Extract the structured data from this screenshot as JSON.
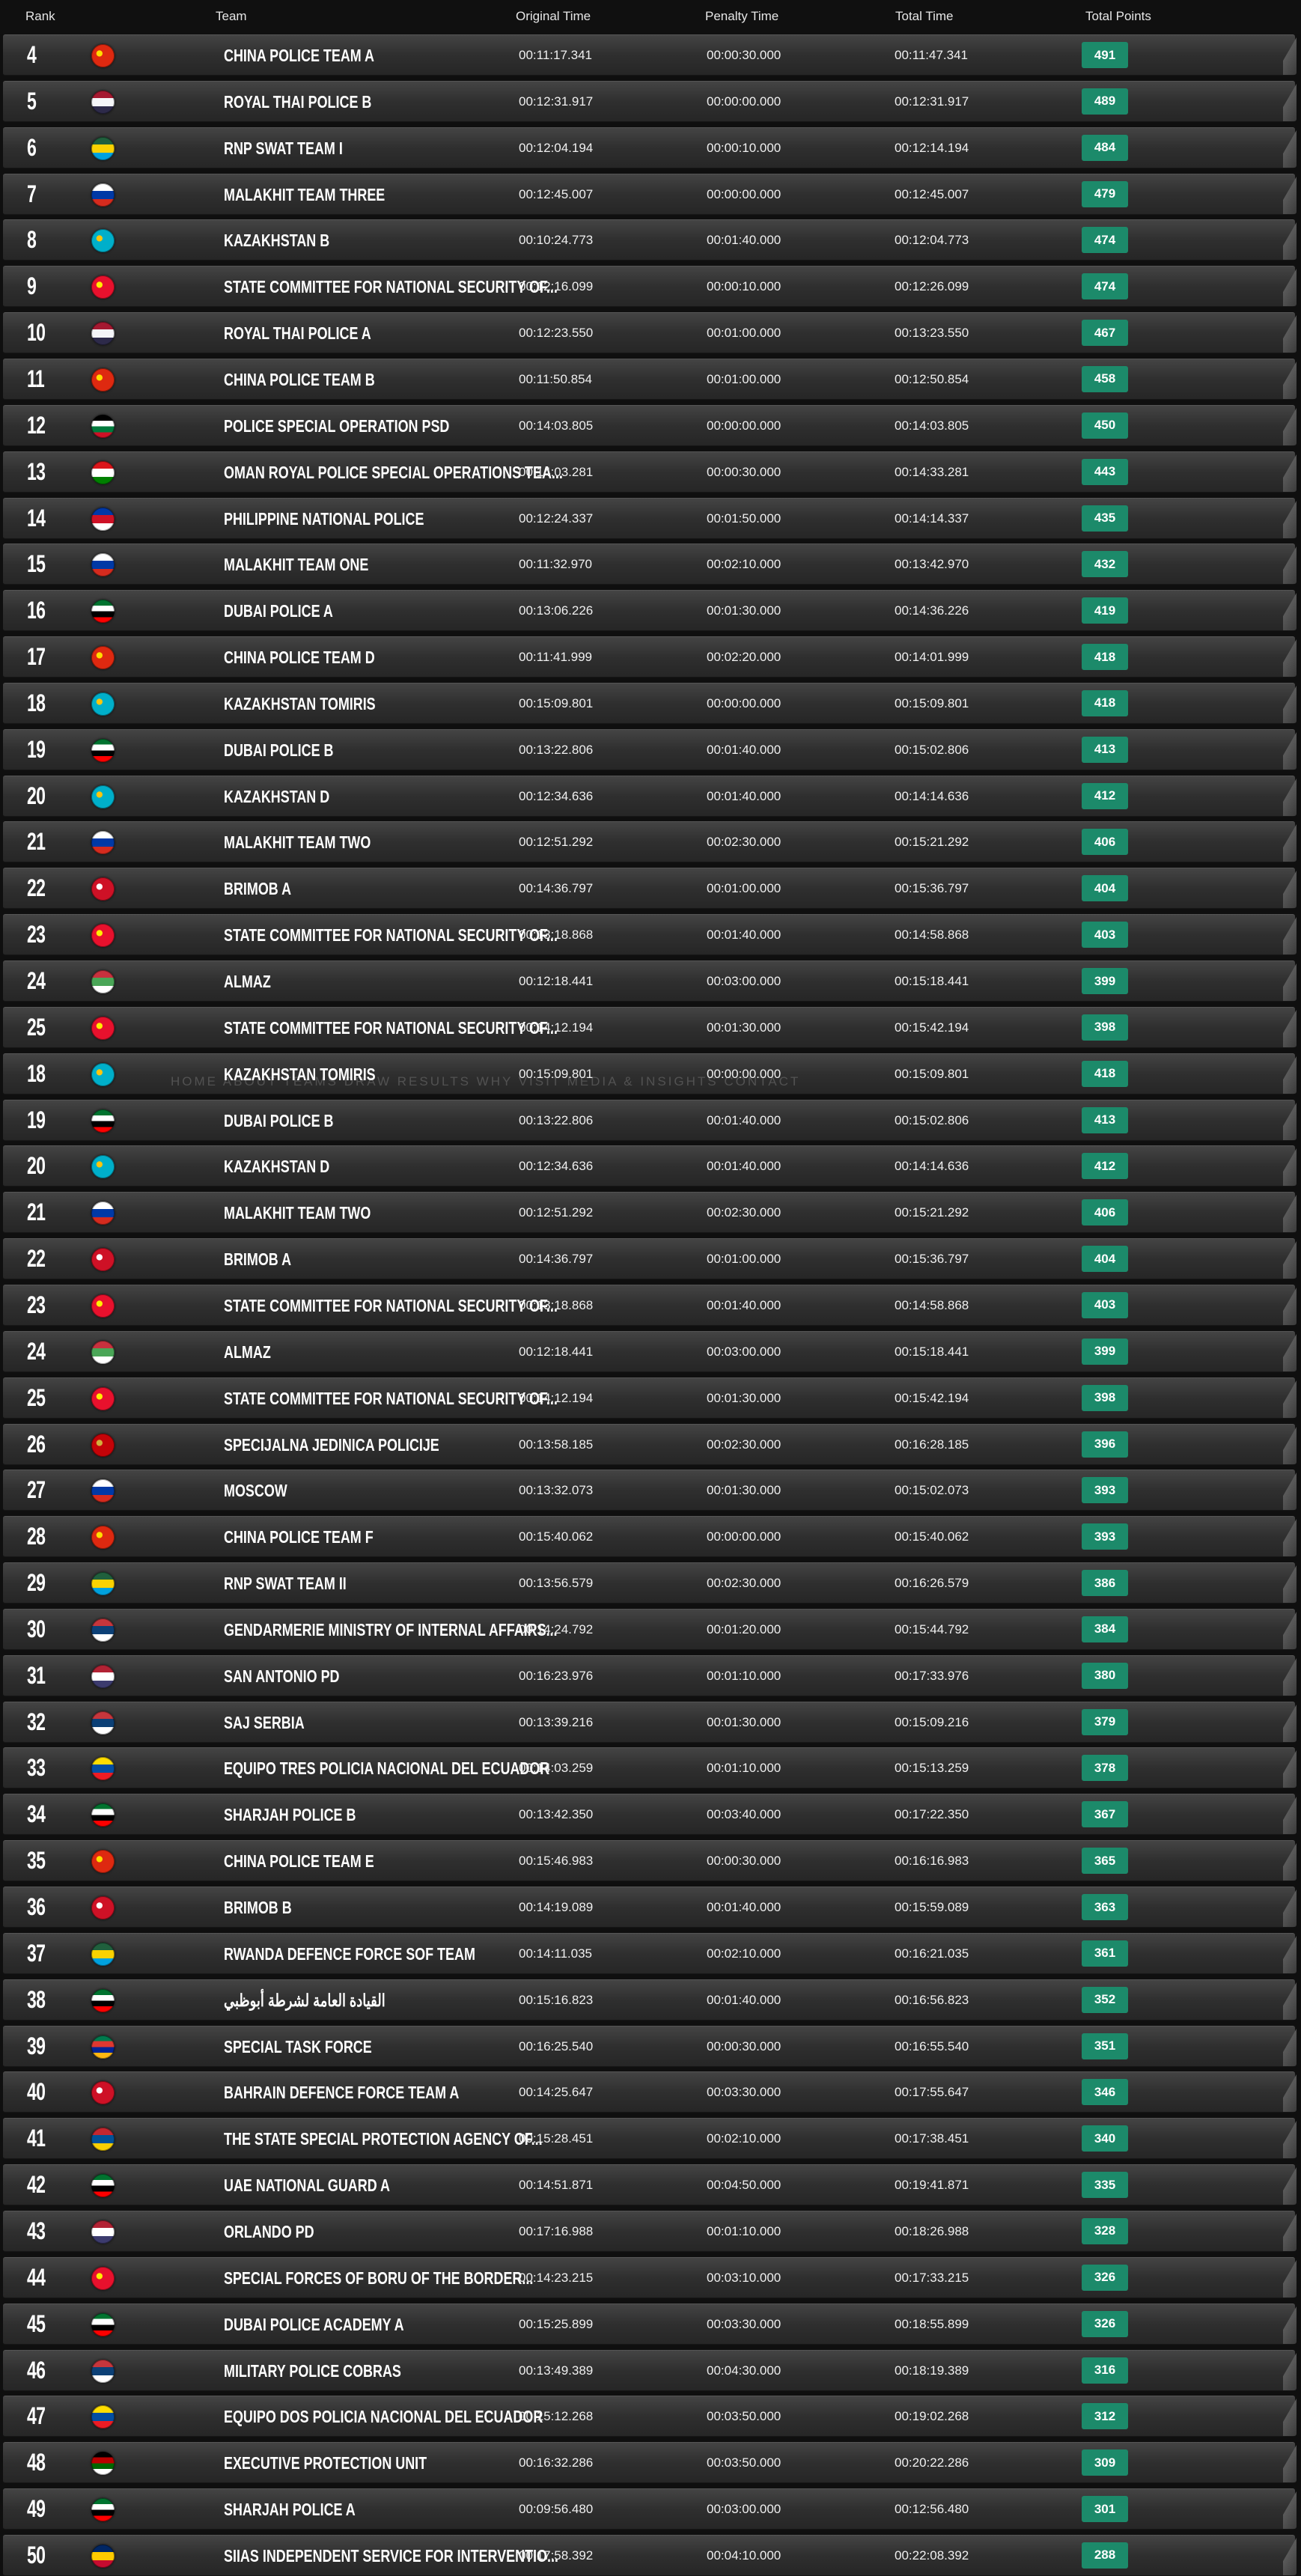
{
  "colors": {
    "points_badge": "#1c8a6a",
    "row_background": "#2f2f2f",
    "page_background": "#0f0f0f"
  },
  "header": {
    "rank": "Rank",
    "team": "Team",
    "original_time": "Original Time",
    "penalty_time": "Penalty Time",
    "total_time": "Total Time",
    "total_points": "Total Points"
  },
  "ghost_nav": "HOME   ABOUT   TEAMS   DRAW   RESULTS   WHY VISIT   MEDIA & INSIGHTS   CONTACT",
  "rows": [
    {
      "rank": "4",
      "flag": "china-flag-icon",
      "flag_colors": [
        "#de2910",
        "#ffde00"
      ],
      "team": "CHINA POLICE TEAM A",
      "original": "00:11:17.341",
      "penalty": "00:00:30.000",
      "total": "00:11:47.341",
      "points": "491"
    },
    {
      "rank": "5",
      "flag": "thailand-flag-icon",
      "flag_colors": [
        "#a51931",
        "#f4f5f8",
        "#2d2a4a"
      ],
      "team": "ROYAL THAI POLICE B",
      "original": "00:12:31.917",
      "penalty": "00:00:00.000",
      "total": "00:12:31.917",
      "points": "489"
    },
    {
      "rank": "6",
      "flag": "rwanda-flag-icon",
      "flag_colors": [
        "#20603d",
        "#fad201",
        "#00a1de"
      ],
      "team": "RNP SWAT TEAM I",
      "original": "00:12:04.194",
      "penalty": "00:00:10.000",
      "total": "00:12:14.194",
      "points": "484"
    },
    {
      "rank": "7",
      "flag": "russia-flag-icon",
      "flag_colors": [
        "#ffffff",
        "#0039a6",
        "#d52b1e"
      ],
      "team": "MALAKHIT TEAM THREE",
      "original": "00:12:45.007",
      "penalty": "00:00:00.000",
      "total": "00:12:45.007",
      "points": "479"
    },
    {
      "rank": "8",
      "flag": "kazakhstan-flag-icon",
      "flag_colors": [
        "#00afca",
        "#fec50c"
      ],
      "team": "KAZAKHSTAN B",
      "original": "00:10:24.773",
      "penalty": "00:01:40.000",
      "total": "00:12:04.773",
      "points": "474"
    },
    {
      "rank": "9",
      "flag": "kyrgyzstan-flag-icon",
      "flag_colors": [
        "#e8112d",
        "#ffef00"
      ],
      "team": "STATE COMMITTEE FOR NATIONAL SECURITY OF...",
      "original": "00:12:16.099",
      "penalty": "00:00:10.000",
      "total": "00:12:26.099",
      "points": "474"
    },
    {
      "rank": "10",
      "flag": "thailand-flag-icon",
      "flag_colors": [
        "#a51931",
        "#f4f5f8",
        "#2d2a4a"
      ],
      "team": "ROYAL THAI POLICE A",
      "original": "00:12:23.550",
      "penalty": "00:01:00.000",
      "total": "00:13:23.550",
      "points": "467"
    },
    {
      "rank": "11",
      "flag": "china-flag-icon",
      "flag_colors": [
        "#de2910",
        "#ffde00"
      ],
      "team": "CHINA POLICE TEAM B",
      "original": "00:11:50.854",
      "penalty": "00:01:00.000",
      "total": "00:12:50.854",
      "points": "458"
    },
    {
      "rank": "12",
      "flag": "jordan-flag-icon",
      "flag_colors": [
        "#000000",
        "#ffffff",
        "#007a3d",
        "#ce1126"
      ],
      "team": "POLICE SPECIAL OPERATION PSD",
      "original": "00:14:03.805",
      "penalty": "00:00:00.000",
      "total": "00:14:03.805",
      "points": "450"
    },
    {
      "rank": "13",
      "flag": "oman-flag-icon",
      "flag_colors": [
        "#db161b",
        "#ffffff",
        "#008000"
      ],
      "team": "OMAN ROYAL POLICE SPECIAL OPERATIONS TEA...",
      "original": "00:14:03.281",
      "penalty": "00:00:30.000",
      "total": "00:14:33.281",
      "points": "443"
    },
    {
      "rank": "14",
      "flag": "philippines-flag-icon",
      "flag_colors": [
        "#0038a8",
        "#ce1126",
        "#ffffff"
      ],
      "team": "PHILIPPINE NATIONAL POLICE",
      "original": "00:12:24.337",
      "penalty": "00:01:50.000",
      "total": "00:14:14.337",
      "points": "435"
    },
    {
      "rank": "15",
      "flag": "russia-flag-icon",
      "flag_colors": [
        "#ffffff",
        "#0039a6",
        "#d52b1e"
      ],
      "team": "MALAKHIT TEAM ONE",
      "original": "00:11:32.970",
      "penalty": "00:02:10.000",
      "total": "00:13:42.970",
      "points": "432"
    },
    {
      "rank": "16",
      "flag": "uae-flag-icon",
      "flag_colors": [
        "#00732f",
        "#ffffff",
        "#000000",
        "#ff0000"
      ],
      "team": "DUBAI POLICE A",
      "original": "00:13:06.226",
      "penalty": "00:01:30.000",
      "total": "00:14:36.226",
      "points": "419"
    },
    {
      "rank": "17",
      "flag": "china-flag-icon",
      "flag_colors": [
        "#de2910",
        "#ffde00"
      ],
      "team": "CHINA POLICE TEAM D",
      "original": "00:11:41.999",
      "penalty": "00:02:20.000",
      "total": "00:14:01.999",
      "points": "418"
    },
    {
      "rank": "18",
      "flag": "kazakhstan-flag-icon",
      "flag_colors": [
        "#00afca",
        "#fec50c"
      ],
      "team": "KAZAKHSTAN TOMIRIS",
      "original": "00:15:09.801",
      "penalty": "00:00:00.000",
      "total": "00:15:09.801",
      "points": "418"
    },
    {
      "rank": "19",
      "flag": "uae-flag-icon",
      "flag_colors": [
        "#00732f",
        "#ffffff",
        "#000000",
        "#ff0000"
      ],
      "team": "DUBAI POLICE B",
      "original": "00:13:22.806",
      "penalty": "00:01:40.000",
      "total": "00:15:02.806",
      "points": "413"
    },
    {
      "rank": "20",
      "flag": "kazakhstan-flag-icon",
      "flag_colors": [
        "#00afca",
        "#fec50c"
      ],
      "team": "KAZAKHSTAN D",
      "original": "00:12:34.636",
      "penalty": "00:01:40.000",
      "total": "00:14:14.636",
      "points": "412"
    },
    {
      "rank": "21",
      "flag": "russia-flag-icon",
      "flag_colors": [
        "#ffffff",
        "#0039a6",
        "#d52b1e"
      ],
      "team": "MALAKHIT TEAM TWO",
      "original": "00:12:51.292",
      "penalty": "00:02:30.000",
      "total": "00:15:21.292",
      "points": "406"
    },
    {
      "rank": "22",
      "flag": "indonesia-flag-icon",
      "flag_colors": [
        "#ce1126",
        "#ffffff"
      ],
      "team": "BRIMOB A",
      "original": "00:14:36.797",
      "penalty": "00:01:00.000",
      "total": "00:15:36.797",
      "points": "404"
    },
    {
      "rank": "23",
      "flag": "kyrgyzstan-flag-icon",
      "flag_colors": [
        "#e8112d",
        "#ffef00"
      ],
      "team": "STATE COMMITTEE FOR NATIONAL SECURITY OF...",
      "original": "00:13:18.868",
      "penalty": "00:01:40.000",
      "total": "00:14:58.868",
      "points": "403"
    },
    {
      "rank": "24",
      "flag": "belarus-flag-icon",
      "flag_colors": [
        "#c8313e",
        "#4aa657",
        "#ffffff"
      ],
      "team": "ALMAZ",
      "original": "00:12:18.441",
      "penalty": "00:03:00.000",
      "total": "00:15:18.441",
      "points": "399"
    },
    {
      "rank": "25",
      "flag": "kyrgyzstan-flag-icon",
      "flag_colors": [
        "#e8112d",
        "#ffef00"
      ],
      "team": "STATE COMMITTEE FOR NATIONAL SECURITY OF...",
      "original": "00:14:12.194",
      "penalty": "00:01:30.000",
      "total": "00:15:42.194",
      "points": "398"
    },
    {
      "rank": "18",
      "flag": "kazakhstan-flag-icon",
      "flag_colors": [
        "#00afca",
        "#fec50c"
      ],
      "team": "KAZAKHSTAN TOMIRIS",
      "original": "00:15:09.801",
      "penalty": "00:00:00.000",
      "total": "00:15:09.801",
      "points": "418"
    },
    {
      "rank": "19",
      "flag": "uae-flag-icon",
      "flag_colors": [
        "#00732f",
        "#ffffff",
        "#000000",
        "#ff0000"
      ],
      "team": "DUBAI POLICE B",
      "original": "00:13:22.806",
      "penalty": "00:01:40.000",
      "total": "00:15:02.806",
      "points": "413"
    },
    {
      "rank": "20",
      "flag": "kazakhstan-flag-icon",
      "flag_colors": [
        "#00afca",
        "#fec50c"
      ],
      "team": "KAZAKHSTAN D",
      "original": "00:12:34.636",
      "penalty": "00:01:40.000",
      "total": "00:14:14.636",
      "points": "412"
    },
    {
      "rank": "21",
      "flag": "russia-flag-icon",
      "flag_colors": [
        "#ffffff",
        "#0039a6",
        "#d52b1e"
      ],
      "team": "MALAKHIT TEAM TWO",
      "original": "00:12:51.292",
      "penalty": "00:02:30.000",
      "total": "00:15:21.292",
      "points": "406"
    },
    {
      "rank": "22",
      "flag": "indonesia-flag-icon",
      "flag_colors": [
        "#ce1126",
        "#ffffff"
      ],
      "team": "BRIMOB A",
      "original": "00:14:36.797",
      "penalty": "00:01:00.000",
      "total": "00:15:36.797",
      "points": "404"
    },
    {
      "rank": "23",
      "flag": "kyrgyzstan-flag-icon",
      "flag_colors": [
        "#e8112d",
        "#ffef00"
      ],
      "team": "STATE COMMITTEE FOR NATIONAL SECURITY OF...",
      "original": "00:13:18.868",
      "penalty": "00:01:40.000",
      "total": "00:14:58.868",
      "points": "403"
    },
    {
      "rank": "24",
      "flag": "belarus-flag-icon",
      "flag_colors": [
        "#c8313e",
        "#4aa657",
        "#ffffff"
      ],
      "team": "ALMAZ",
      "original": "00:12:18.441",
      "penalty": "00:03:00.000",
      "total": "00:15:18.441",
      "points": "399"
    },
    {
      "rank": "25",
      "flag": "kyrgyzstan-flag-icon",
      "flag_colors": [
        "#e8112d",
        "#ffef00"
      ],
      "team": "STATE COMMITTEE FOR NATIONAL SECURITY OF...",
      "original": "00:14:12.194",
      "penalty": "00:01:30.000",
      "total": "00:15:42.194",
      "points": "398"
    },
    {
      "rank": "26",
      "flag": "montenegro-flag-icon",
      "flag_colors": [
        "#c40308",
        "#d3ae3b"
      ],
      "team": "SPECIJALNA JEDINICA POLICIJE",
      "original": "00:13:58.185",
      "penalty": "00:02:30.000",
      "total": "00:16:28.185",
      "points": "396"
    },
    {
      "rank": "27",
      "flag": "russia-flag-icon",
      "flag_colors": [
        "#ffffff",
        "#0039a6",
        "#d52b1e"
      ],
      "team": "MOSCOW",
      "original": "00:13:32.073",
      "penalty": "00:01:30.000",
      "total": "00:15:02.073",
      "points": "393"
    },
    {
      "rank": "28",
      "flag": "china-flag-icon",
      "flag_colors": [
        "#de2910",
        "#ffde00"
      ],
      "team": "CHINA POLICE TEAM F",
      "original": "00:15:40.062",
      "penalty": "00:00:00.000",
      "total": "00:15:40.062",
      "points": "393"
    },
    {
      "rank": "29",
      "flag": "rwanda-flag-icon",
      "flag_colors": [
        "#20603d",
        "#fad201",
        "#00a1de"
      ],
      "team": "RNP SWAT TEAM II",
      "original": "00:13:56.579",
      "penalty": "00:02:30.000",
      "total": "00:16:26.579",
      "points": "386"
    },
    {
      "rank": "30",
      "flag": "serbia-flag-icon",
      "flag_colors": [
        "#c6363c",
        "#0c4076",
        "#ffffff"
      ],
      "team": "GENDARMERIE MINISTRY OF INTERNAL AFFAIRS...",
      "original": "00:14:24.792",
      "penalty": "00:01:20.000",
      "total": "00:15:44.792",
      "points": "384"
    },
    {
      "rank": "31",
      "flag": "usa-flag-icon",
      "flag_colors": [
        "#b22234",
        "#ffffff",
        "#3c3b6e"
      ],
      "team": "SAN ANTONIO PD",
      "original": "00:16:23.976",
      "penalty": "00:01:10.000",
      "total": "00:17:33.976",
      "points": "380"
    },
    {
      "rank": "32",
      "flag": "serbia-flag-icon",
      "flag_colors": [
        "#c6363c",
        "#0c4076",
        "#ffffff"
      ],
      "team": "SAJ SERBIA",
      "original": "00:13:39.216",
      "penalty": "00:01:30.000",
      "total": "00:15:09.216",
      "points": "379"
    },
    {
      "rank": "33",
      "flag": "ecuador-flag-icon",
      "flag_colors": [
        "#ffdd00",
        "#034ea2",
        "#ed1c24"
      ],
      "team": "EQUIPO TRES POLICIA NACIONAL DEL ECUADOR",
      "original": "00:14:03.259",
      "penalty": "00:01:10.000",
      "total": "00:15:13.259",
      "points": "378"
    },
    {
      "rank": "34",
      "flag": "uae-flag-icon",
      "flag_colors": [
        "#00732f",
        "#ffffff",
        "#000000",
        "#ff0000"
      ],
      "team": "SHARJAH POLICE B",
      "original": "00:13:42.350",
      "penalty": "00:03:40.000",
      "total": "00:17:22.350",
      "points": "367"
    },
    {
      "rank": "35",
      "flag": "china-flag-icon",
      "flag_colors": [
        "#de2910",
        "#ffde00"
      ],
      "team": "CHINA POLICE TEAM E",
      "original": "00:15:46.983",
      "penalty": "00:00:30.000",
      "total": "00:16:16.983",
      "points": "365"
    },
    {
      "rank": "36",
      "flag": "indonesia-flag-icon",
      "flag_colors": [
        "#ce1126",
        "#ffffff"
      ],
      "team": "BRIMOB B",
      "original": "00:14:19.089",
      "penalty": "00:01:40.000",
      "total": "00:15:59.089",
      "points": "363"
    },
    {
      "rank": "37",
      "flag": "rwanda-flag-icon",
      "flag_colors": [
        "#20603d",
        "#fad201",
        "#00a1de"
      ],
      "team": "RWANDA DEFENCE FORCE SOF TEAM",
      "original": "00:14:11.035",
      "penalty": "00:02:10.000",
      "total": "00:16:21.035",
      "points": "361"
    },
    {
      "rank": "38",
      "flag": "uae-flag-icon",
      "flag_colors": [
        "#00732f",
        "#ffffff",
        "#000000",
        "#ff0000"
      ],
      "team": "القيادة العامة لشرطة أبوظبي",
      "original": "00:15:16.823",
      "penalty": "00:01:40.000",
      "total": "00:16:56.823",
      "points": "352"
    },
    {
      "rank": "39",
      "flag": "south-africa-flag-icon",
      "flag_colors": [
        "#007a4d",
        "#de3831",
        "#002395",
        "#ffb612"
      ],
      "team": "SPECIAL TASK FORCE",
      "original": "00:16:25.540",
      "penalty": "00:00:30.000",
      "total": "00:16:55.540",
      "points": "351"
    },
    {
      "rank": "40",
      "flag": "bahrain-flag-icon",
      "flag_colors": [
        "#ce1126",
        "#ffffff"
      ],
      "team": "BAHRAIN DEFENCE FORCE TEAM A",
      "original": "00:14:25.647",
      "penalty": "00:03:30.000",
      "total": "00:17:55.647",
      "points": "346"
    },
    {
      "rank": "41",
      "flag": "mongolia-flag-icon",
      "flag_colors": [
        "#c4272f",
        "#015197",
        "#f9cf02"
      ],
      "team": "THE STATE SPECIAL PROTECTION AGENCY OF...",
      "original": "00:15:28.451",
      "penalty": "00:02:10.000",
      "total": "00:17:38.451",
      "points": "340"
    },
    {
      "rank": "42",
      "flag": "uae-flag-icon",
      "flag_colors": [
        "#00732f",
        "#ffffff",
        "#000000",
        "#ff0000"
      ],
      "team": "UAE NATIONAL GUARD A",
      "original": "00:14:51.871",
      "penalty": "00:04:50.000",
      "total": "00:19:41.871",
      "points": "335"
    },
    {
      "rank": "43",
      "flag": "usa-flag-icon",
      "flag_colors": [
        "#b22234",
        "#ffffff",
        "#3c3b6e"
      ],
      "team": "ORLANDO PD",
      "original": "00:17:16.988",
      "penalty": "00:01:10.000",
      "total": "00:18:26.988",
      "points": "328"
    },
    {
      "rank": "44",
      "flag": "kyrgyzstan-flag-icon",
      "flag_colors": [
        "#e8112d",
        "#ffef00"
      ],
      "team": "SPECIAL FORCES OF BORU OF THE BORDER...",
      "original": "00:14:23.215",
      "penalty": "00:03:10.000",
      "total": "00:17:33.215",
      "points": "326"
    },
    {
      "rank": "45",
      "flag": "uae-flag-icon",
      "flag_colors": [
        "#00732f",
        "#ffffff",
        "#000000",
        "#ff0000"
      ],
      "team": "DUBAI POLICE ACADEMY A",
      "original": "00:15:25.899",
      "penalty": "00:03:30.000",
      "total": "00:18:55.899",
      "points": "326"
    },
    {
      "rank": "46",
      "flag": "serbia-flag-icon",
      "flag_colors": [
        "#c6363c",
        "#0c4076",
        "#ffffff"
      ],
      "team": "MILITARY POLICE COBRAS",
      "original": "00:13:49.389",
      "penalty": "00:04:30.000",
      "total": "00:18:19.389",
      "points": "316"
    },
    {
      "rank": "47",
      "flag": "ecuador-flag-icon",
      "flag_colors": [
        "#ffdd00",
        "#034ea2",
        "#ed1c24"
      ],
      "team": "EQUIPO DOS POLICIA NACIONAL DEL ECUADOR",
      "original": "00:15:12.268",
      "penalty": "00:03:50.000",
      "total": "00:19:02.268",
      "points": "312"
    },
    {
      "rank": "48",
      "flag": "kenya-flag-icon",
      "flag_colors": [
        "#000000",
        "#bb0000",
        "#006600",
        "#ffffff"
      ],
      "team": "EXECUTIVE PROTECTION UNIT",
      "original": "00:16:32.286",
      "penalty": "00:03:50.000",
      "total": "00:20:22.286",
      "points": "309"
    },
    {
      "rank": "49",
      "flag": "uae-flag-icon",
      "flag_colors": [
        "#00732f",
        "#ffffff",
        "#000000",
        "#ff0000"
      ],
      "team": "SHARJAH POLICE A",
      "original": "00:09:56.480",
      "penalty": "00:03:00.000",
      "total": "00:12:56.480",
      "points": "301"
    },
    {
      "rank": "50",
      "flag": "chad-flag-icon",
      "flag_colors": [
        "#002664",
        "#fecb00",
        "#c60c30"
      ],
      "team": "SIIAS INDEPENDENT SERVICE FOR INTERVENTIO...",
      "original": "00:17:58.392",
      "penalty": "00:04:10.000",
      "total": "00:22:08.392",
      "points": "288"
    }
  ]
}
